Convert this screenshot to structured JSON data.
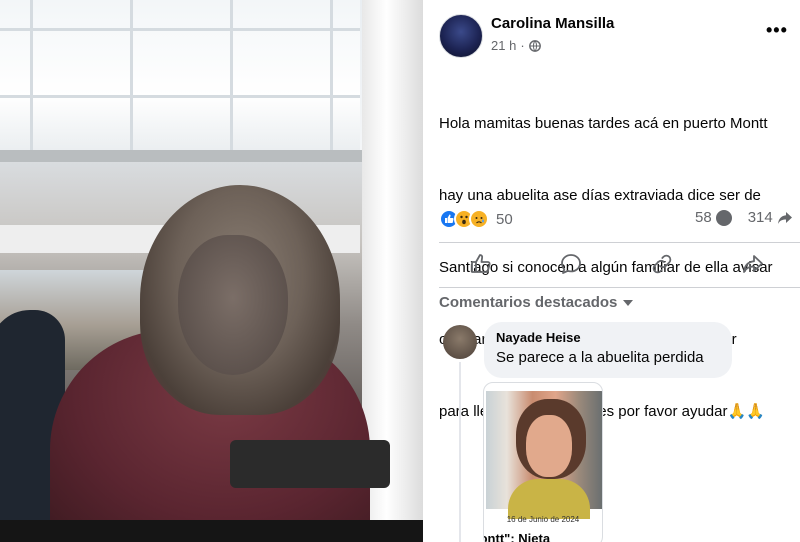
{
  "post": {
    "author": "Carolina Mansilla",
    "time": "21 h",
    "text_lines": [
      "Hola mamitas buenas tardes acá en puerto Montt",
      "hay una abuelita ase días extraviada dice ser de",
      "Santiago si conocen a algún familiar de ella avisar",
      "o tratar de compartir mi publicación por favor",
      "para llegar a los familiares por favor ayudar🙏🙏"
    ],
    "reaction_count": "50",
    "comment_count": "58",
    "share_count": "314",
    "more_label": "•••"
  },
  "comments": {
    "section_label": "Comentarios destacados",
    "items": [
      {
        "name": "Nayade Heise",
        "text": "Se parece a la abuelita perdida",
        "attachment_date": "16 de Junio de 2024",
        "attachment_headline": "lontt\": Nieta"
      }
    ]
  },
  "colors": {
    "text_primary": "#050505",
    "text_secondary": "#65676b",
    "like_blue": "#1877f2",
    "comment_bg": "#f0f2f5",
    "divider": "#ced0d4"
  },
  "icons": {
    "reactions": [
      "like-reaction-icon",
      "wow-reaction-icon",
      "sad-reaction-icon"
    ],
    "actions": [
      "like-icon",
      "comment-icon",
      "share-link-icon",
      "share-icon"
    ]
  }
}
